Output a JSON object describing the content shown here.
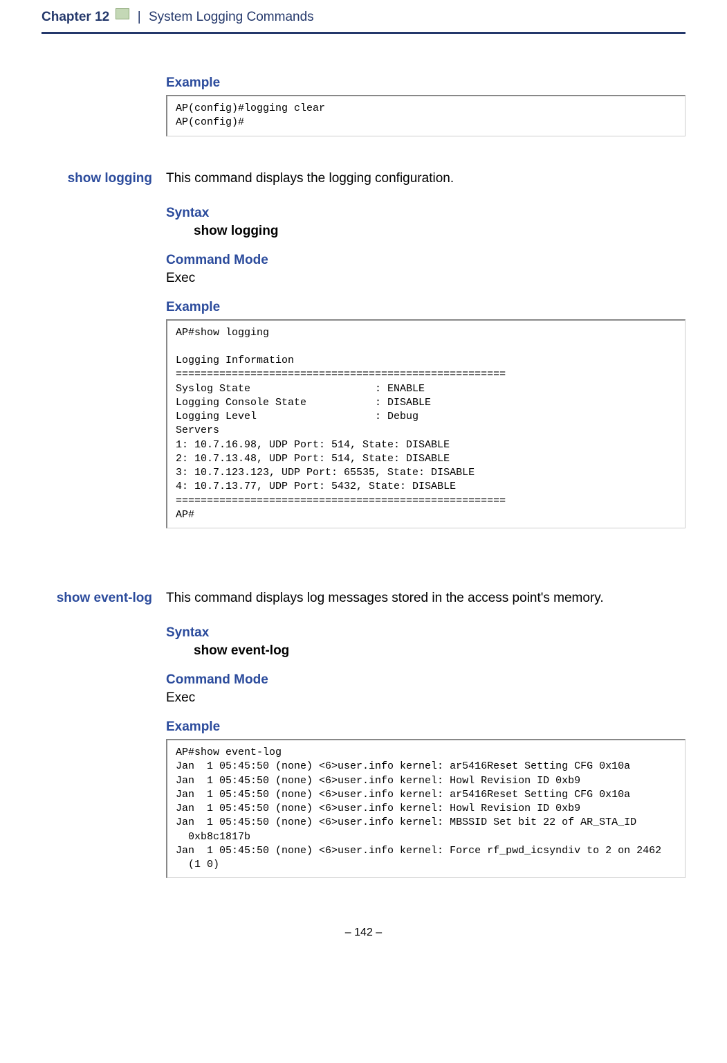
{
  "header": {
    "chapter": "Chapter 12",
    "title": "System Logging Commands"
  },
  "section1": {
    "example_heading": "Example",
    "code": "AP(config)#logging clear\nAP(config)#"
  },
  "section2": {
    "sidelabel": "show logging",
    "description": "This command displays the logging configuration.",
    "syntax_heading": "Syntax",
    "syntax_cmd": "show logging",
    "mode_heading": "Command Mode",
    "mode_value": "Exec",
    "example_heading": "Example",
    "code": "AP#show logging\n\nLogging Information\n=====================================================\nSyslog State                    : ENABLE\nLogging Console State           : DISABLE\nLogging Level                   : Debug\nServers\n1: 10.7.16.98, UDP Port: 514, State: DISABLE\n2: 10.7.13.48, UDP Port: 514, State: DISABLE\n3: 10.7.123.123, UDP Port: 65535, State: DISABLE\n4: 10.7.13.77, UDP Port: 5432, State: DISABLE\n=====================================================\nAP#"
  },
  "section3": {
    "sidelabel": "show event-log",
    "description": "This command displays log messages stored in the access point's memory.",
    "syntax_heading": "Syntax",
    "syntax_cmd": "show event-log",
    "mode_heading": "Command Mode",
    "mode_value": "Exec",
    "example_heading": "Example",
    "code": "AP#show event-log\nJan  1 05:45:50 (none) <6>user.info kernel: ar5416Reset Setting CFG 0x10a\nJan  1 05:45:50 (none) <6>user.info kernel: Howl Revision ID 0xb9\nJan  1 05:45:50 (none) <6>user.info kernel: ar5416Reset Setting CFG 0x10a\nJan  1 05:45:50 (none) <6>user.info kernel: Howl Revision ID 0xb9\nJan  1 05:45:50 (none) <6>user.info kernel: MBSSID Set bit 22 of AR_STA_ID\n  0xb8c1817b\nJan  1 05:45:50 (none) <6>user.info kernel: Force rf_pwd_icsyndiv to 2 on 2462\n  (1 0)"
  },
  "footer": {
    "page": "–  142  –"
  }
}
